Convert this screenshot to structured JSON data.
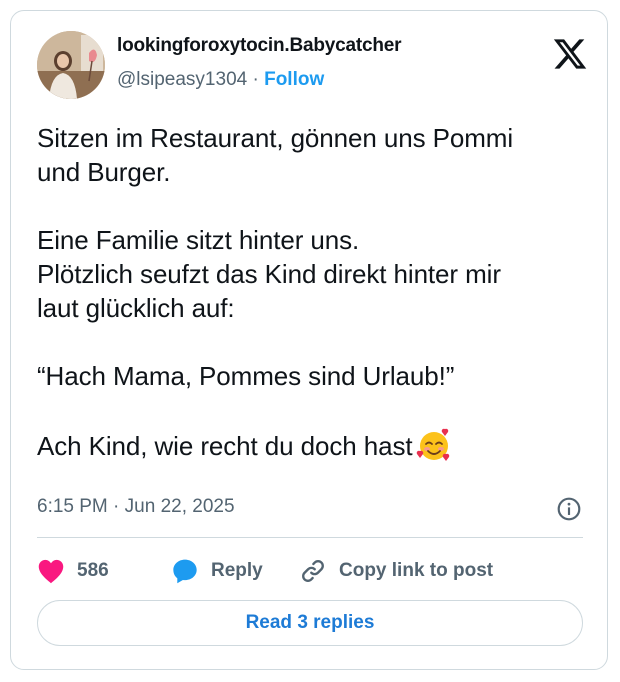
{
  "post": {
    "display_name": "lookingforoxytocin.Babycatcher",
    "handle": "@lsipeasy1304",
    "separator": "·",
    "follow_label": "Follow",
    "text": "Sitzen im Restaurant, gönnen uns Pommi\nund Burger.\n\nEine Familie sitzt hinter uns.\nPlötzlich seufzt das Kind direkt hinter mir\nlaut glücklich auf:\n\n“Hach Mama, Pommes sind Urlaub!”\n\nAch Kind, wie recht du doch hast",
    "time": "6:15 PM",
    "date_separator": "·",
    "date": "Jun 22, 2025"
  },
  "actions": {
    "likes_count": "586",
    "reply_label": "Reply",
    "copy_label": "Copy link to post",
    "read_replies_label": "Read 3 replies"
  },
  "colors": {
    "like": "#f91880",
    "reply": "#1d9bf0",
    "link": "#1d9bf0",
    "muted": "#536471"
  },
  "icons": {
    "brand": "x-logo-icon",
    "emoji": "smiling-face-with-hearts-emoji",
    "info": "info-icon",
    "like": "heart-icon",
    "reply": "speech-bubble-icon",
    "copy": "link-icon"
  }
}
